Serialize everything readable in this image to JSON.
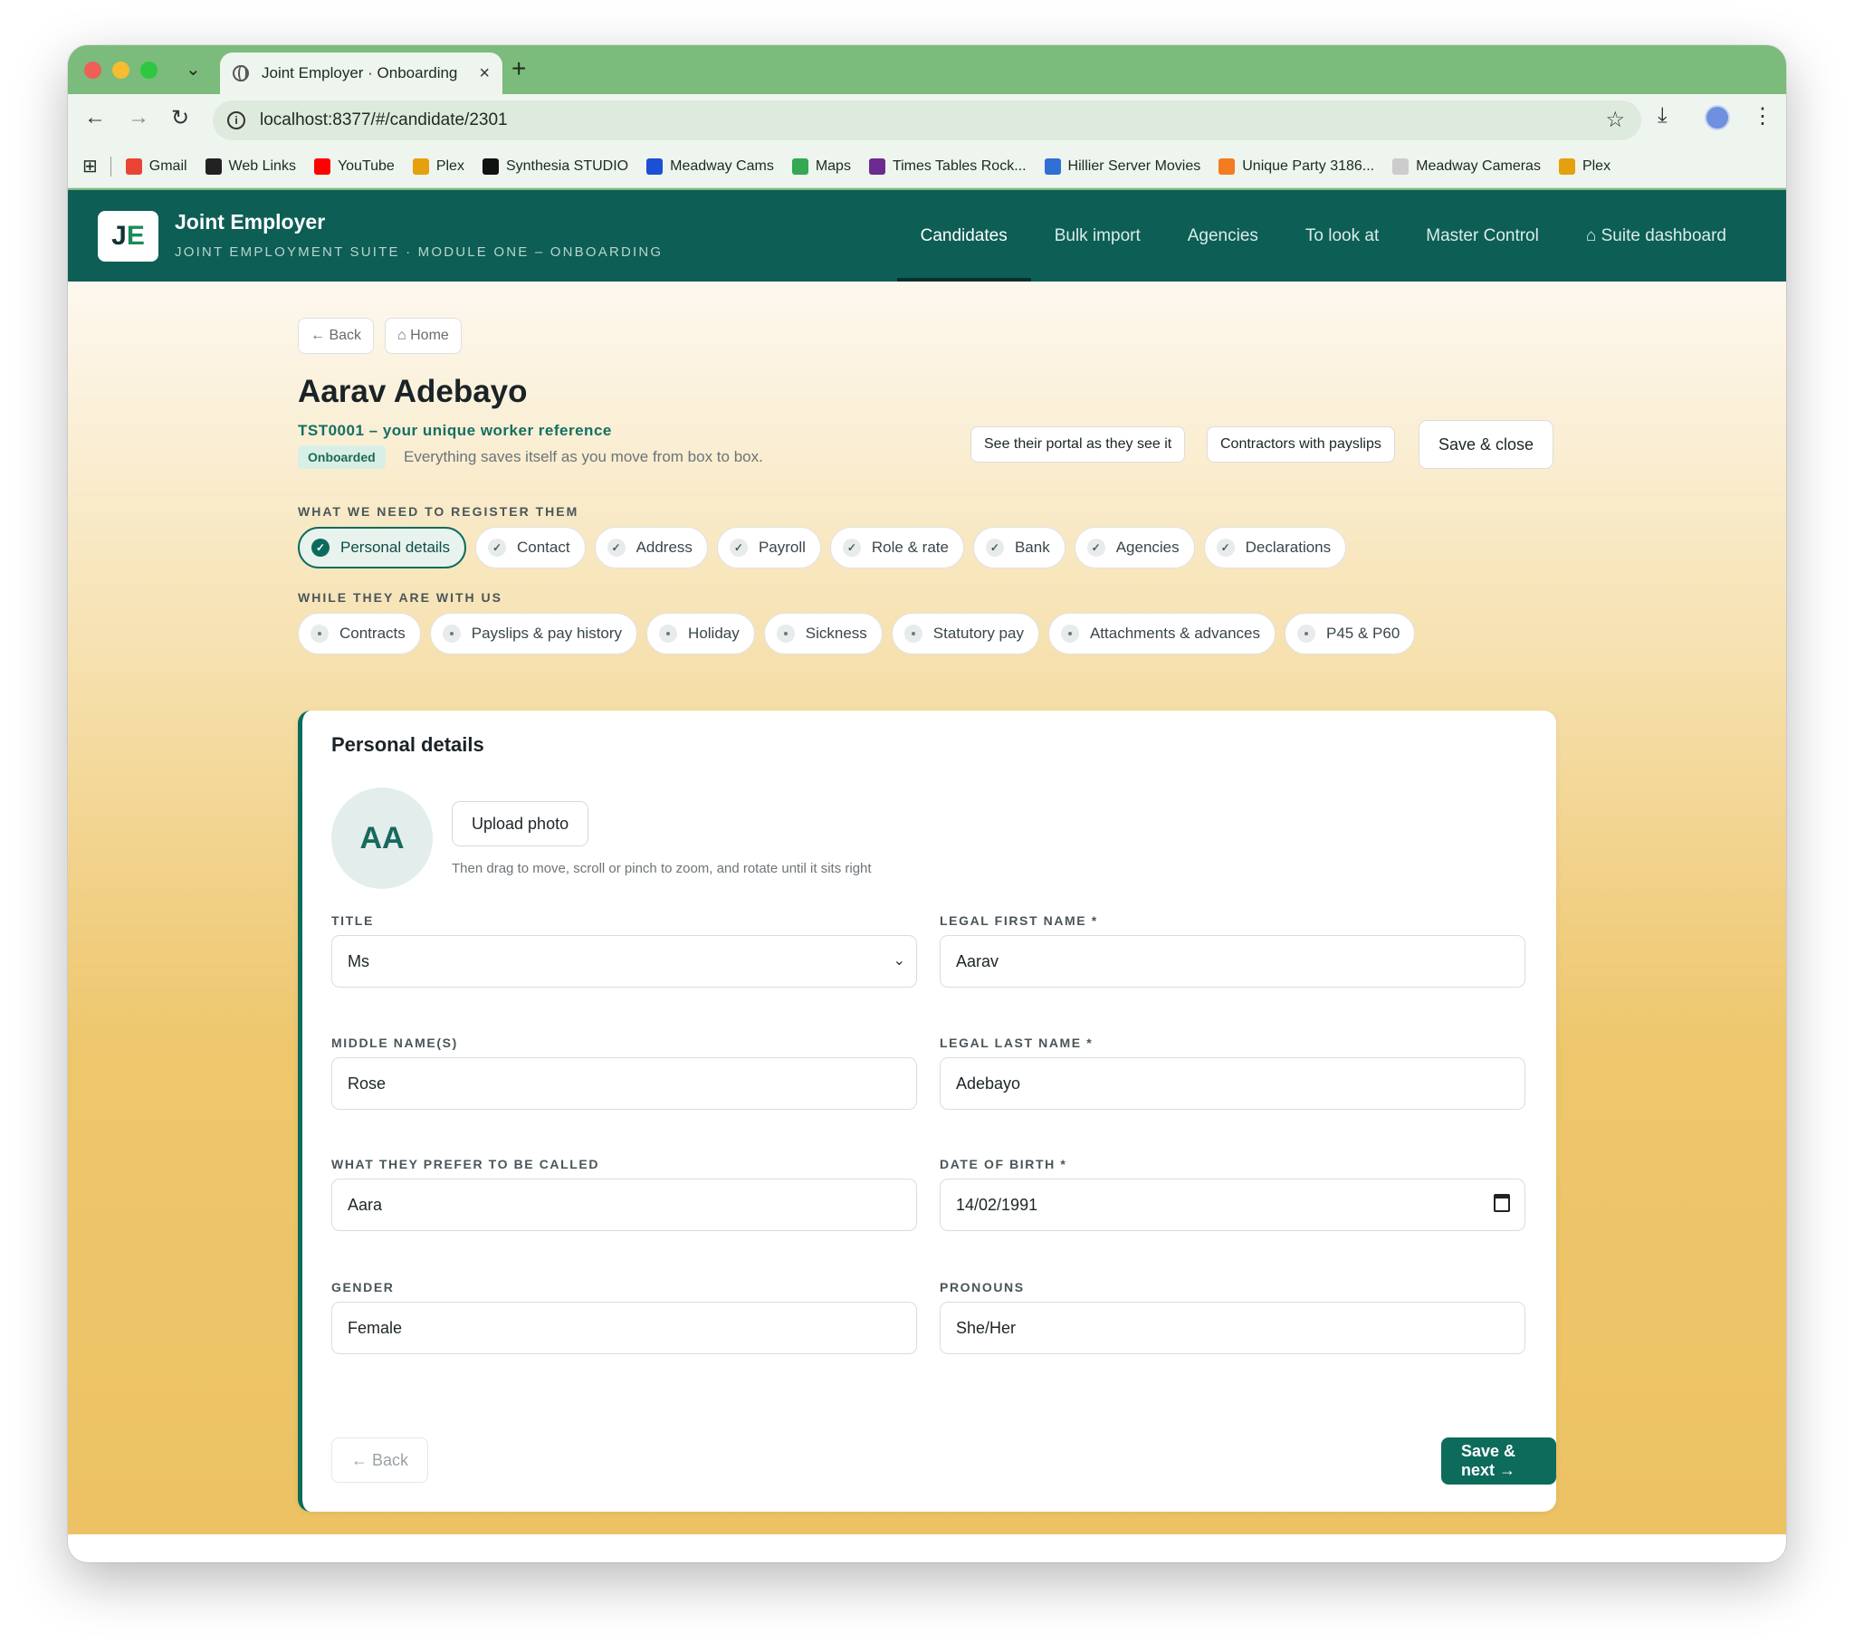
{
  "browser": {
    "tab_title": "Joint Employer · Onboarding",
    "url": "localhost:8377/#/candidate/2301",
    "bookmarks": [
      {
        "label": "Gmail",
        "color": "#ea4335"
      },
      {
        "label": "Web Links",
        "color": "#222222"
      },
      {
        "label": "YouTube",
        "color": "#ff0000"
      },
      {
        "label": "Plex",
        "color": "#e5a00d"
      },
      {
        "label": "Synthesia STUDIO",
        "color": "#111111"
      },
      {
        "label": "Meadway Cams",
        "color": "#1a4fd6"
      },
      {
        "label": "Maps",
        "color": "#34a853"
      },
      {
        "label": "Times Tables Rock...",
        "color": "#6a2c91"
      },
      {
        "label": "Hillier Server Movies",
        "color": "#2f6fd6"
      },
      {
        "label": "Unique Party 3186...",
        "color": "#f47b20"
      },
      {
        "label": "Meadway Cameras",
        "color": "#cccccc"
      },
      {
        "label": "Plex",
        "color": "#e5a00d"
      }
    ]
  },
  "app": {
    "logo_j": "J",
    "logo_e": "E",
    "brand": "Joint Employer",
    "subtitle": "JOINT EMPLOYMENT SUITE · MODULE ONE – ONBOARDING",
    "nav": [
      "Candidates",
      "Bulk import",
      "Agencies",
      "To look at",
      "Master Control",
      "⌂ Suite dashboard"
    ]
  },
  "page": {
    "back": "← Back",
    "home": "⌂ Home",
    "name": "Aarav Adebayo",
    "reference": "TST0001 – your unique worker reference",
    "status": "Onboarded",
    "autosave": "Everything saves itself as you move from box to box.",
    "actions": [
      "See their portal as they see it",
      "Contractors with payslips",
      "Save & close"
    ],
    "register_label": "WHAT WE NEED TO REGISTER THEM",
    "register_steps": [
      "Personal details",
      "Contact",
      "Address",
      "Payroll",
      "Role & rate",
      "Bank",
      "Agencies",
      "Declarations"
    ],
    "with_us_label": "WHILE THEY ARE WITH US",
    "with_us_steps": [
      "Contracts",
      "Payslips & pay history",
      "Holiday",
      "Sickness",
      "Statutory pay",
      "Attachments & advances",
      "P45 & P60"
    ]
  },
  "form": {
    "heading": "Personal details",
    "initials": "AA",
    "upload": "Upload photo",
    "upload_hint": "Then drag to move, scroll or pinch to zoom, and rotate until it sits right",
    "title_label": "TITLE",
    "title_value": "Ms",
    "first_label": "LEGAL FIRST NAME *",
    "first_value": "Aarav",
    "middle_label": "MIDDLE NAME(S)",
    "middle_value": "Rose",
    "last_label": "LEGAL LAST NAME *",
    "last_value": "Adebayo",
    "preferred_label": "WHAT THEY PREFER TO BE CALLED",
    "preferred_value": "Aara",
    "dob_label": "DATE OF BIRTH *",
    "dob_value": "14/02/1991",
    "gender_label": "GENDER",
    "gender_value": "Female",
    "pronouns_label": "PRONOUNS",
    "pronouns_value": "She/Her",
    "back": "← Back",
    "save_next": "Save & next →"
  }
}
